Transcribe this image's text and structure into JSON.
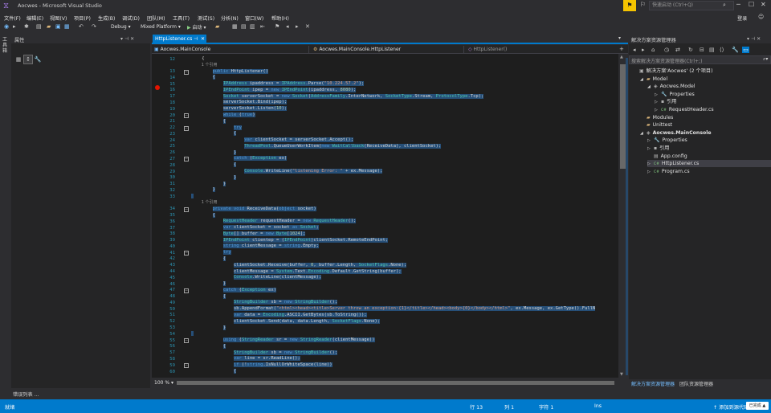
{
  "window": {
    "title": "Aocwes - Microsoft Visual Studio",
    "quick_launch_placeholder": "快速启动 (Ctrl+Q)",
    "login": "登录"
  },
  "menu": [
    "文件(F)",
    "编辑(E)",
    "视图(V)",
    "项目(P)",
    "生成(B)",
    "调试(D)",
    "团队(M)",
    "工具(T)",
    "测试(S)",
    "分析(N)",
    "窗口(W)",
    "帮助(H)"
  ],
  "toolbar": {
    "configuration": "Debug",
    "platform": "Mixed Platform",
    "run_label": "启动"
  },
  "toolstrip": {
    "label": "工具箱"
  },
  "properties": {
    "title": "属性"
  },
  "error_list": {
    "title": "错误列表 ..."
  },
  "editor": {
    "tab_title": "HttpListener.cs",
    "nav_project": "Aocwes.MainConsole",
    "nav_class": "Aocwes.MainConsole.HttpListener",
    "nav_member": "HttpListener()",
    "zoom": "100 %",
    "lines": [
      {
        "n": "12",
        "t": "    {",
        "sel": false
      },
      {
        "n": "",
        "t": "        1 个引用",
        "lens": true
      },
      {
        "n": "13",
        "t": "        public HttpListener()",
        "sel": true
      },
      {
        "n": "14",
        "t": "        {",
        "sel": true
      },
      {
        "n": "15",
        "t": "            IPAddress ipaddress = IPAddress.Parse(\"10.224.57.2\");",
        "sel": true
      },
      {
        "n": "16",
        "t": "            IPEndPoint ipep = new IPEndPoint(ipaddress, 8080);",
        "sel": true
      },
      {
        "n": "17",
        "t": "            Socket serverSocket = new Socket(AddressFamily.InterNetwork, SocketType.Stream, ProtocolType.Tcp);",
        "sel": true
      },
      {
        "n": "18",
        "t": "            serverSocket.Bind(ipep);",
        "sel": true
      },
      {
        "n": "19",
        "t": "            serverSocket.Listen(10);",
        "sel": true
      },
      {
        "n": "20",
        "t": "            while (true)",
        "sel": true
      },
      {
        "n": "21",
        "t": "            {",
        "sel": true
      },
      {
        "n": "22",
        "t": "                try",
        "sel": true
      },
      {
        "n": "23",
        "t": "                {",
        "sel": true
      },
      {
        "n": "24",
        "t": "                    var clientSocket = serverSocket.Accept();",
        "sel": true
      },
      {
        "n": "25",
        "t": "                    ThreadPool.QueueUserWorkItem(new WaitCallback(ReceiveData), clientSocket);",
        "sel": true
      },
      {
        "n": "26",
        "t": "                }",
        "sel": true
      },
      {
        "n": "27",
        "t": "                catch (Exception ex)",
        "sel": true
      },
      {
        "n": "28",
        "t": "                {",
        "sel": true
      },
      {
        "n": "29",
        "t": "                    Console.WriteLine(\"listening Error: \" + ex.Message);",
        "sel": true
      },
      {
        "n": "30",
        "t": "                }",
        "sel": true
      },
      {
        "n": "31",
        "t": "            }",
        "sel": true
      },
      {
        "n": "32",
        "t": "        }",
        "sel": true
      },
      {
        "n": "33",
        "t": "",
        "sel": true
      },
      {
        "n": "",
        "t": "        1 个引用",
        "lens": true
      },
      {
        "n": "34",
        "t": "        private void ReceiveData(object socket)",
        "sel": true
      },
      {
        "n": "35",
        "t": "        {",
        "sel": true
      },
      {
        "n": "36",
        "t": "            RequestHeader requestHeader = new RequestHeader();",
        "sel": true
      },
      {
        "n": "37",
        "t": "            var clientSocket = socket as Socket;",
        "sel": true
      },
      {
        "n": "38",
        "t": "            Byte[] buffer = new Byte[1024];",
        "sel": true
      },
      {
        "n": "39",
        "t": "            IPEndPoint clientep = (IPEndPoint)clientSocket.RemoteEndPoint;",
        "sel": true
      },
      {
        "n": "40",
        "t": "            string clientMessage = string.Empty;",
        "sel": true
      },
      {
        "n": "41",
        "t": "            try",
        "sel": true
      },
      {
        "n": "42",
        "t": "            {",
        "sel": true
      },
      {
        "n": "43",
        "t": "                clientSocket.Receive(buffer, 0, buffer.Length, SocketFlags.None);",
        "sel": true
      },
      {
        "n": "44",
        "t": "                clientMessage = System.Text.Encoding.Default.GetString(buffer);",
        "sel": true
      },
      {
        "n": "45",
        "t": "                Console.WriteLine(clientMessage);",
        "sel": true
      },
      {
        "n": "46",
        "t": "            }",
        "sel": true
      },
      {
        "n": "47",
        "t": "            catch (Exception ex)",
        "sel": true
      },
      {
        "n": "48",
        "t": "            {",
        "sel": true
      },
      {
        "n": "49",
        "t": "                StringBuilder sb = new StringBuilder();",
        "sel": true
      },
      {
        "n": "50",
        "t": "                sb.AppendFormat(\"<html><head><title>Server throw an exception:{1}</title></head><body>{0}</body></html>\", ex.Message, ex.GetType().FullN",
        "sel": true
      },
      {
        "n": "51",
        "t": "                var data = Encoding.ASCII.GetBytes(sb.ToString());",
        "sel": true
      },
      {
        "n": "52",
        "t": "                clientSocket.Send(data, data.Length, SocketFlags.None);",
        "sel": true
      },
      {
        "n": "53",
        "t": "            }",
        "sel": true
      },
      {
        "n": "54",
        "t": "",
        "sel": true
      },
      {
        "n": "55",
        "t": "            using (StringReader sr = new StringReader(clientMessage))",
        "sel": true
      },
      {
        "n": "56",
        "t": "            {",
        "sel": true
      },
      {
        "n": "57",
        "t": "                StringBuilder sb = new StringBuilder();",
        "sel": true
      },
      {
        "n": "58",
        "t": "                var line = sr.ReadLine();",
        "sel": true
      },
      {
        "n": "59",
        "t": "                if (!string.IsNullOrWhiteSpace(line))",
        "sel": true
      },
      {
        "n": "60",
        "t": "                {",
        "sel": true
      }
    ]
  },
  "solution_explorer": {
    "title": "解决方案资源管理器",
    "search_placeholder": "搜索解决方案资源管理器(Ctrl+;)",
    "items": [
      {
        "label": "解决方案'Aocwes' (2 个项目)",
        "depth": 0,
        "icon": "▣",
        "arrow": "",
        "bold": false
      },
      {
        "label": "Model",
        "depth": 1,
        "icon": "▰",
        "arrow": "◢",
        "bold": false
      },
      {
        "label": "Aocwes.Model",
        "depth": 2,
        "icon": "◈",
        "arrow": "◢",
        "bold": false
      },
      {
        "label": "Properties",
        "depth": 3,
        "icon": "🔧",
        "arrow": "▷",
        "bold": false
      },
      {
        "label": "引用",
        "depth": 3,
        "icon": "▪",
        "arrow": "▷",
        "bold": false
      },
      {
        "label": "RequestHeader.cs",
        "depth": 3,
        "icon": "C#",
        "arrow": "▷",
        "bold": false
      },
      {
        "label": "Modules",
        "depth": 1,
        "icon": "▰",
        "arrow": "",
        "bold": false
      },
      {
        "label": "Unittest",
        "depth": 1,
        "icon": "▰",
        "arrow": "",
        "bold": false
      },
      {
        "label": "Aocwes.MainConsole",
        "depth": 1,
        "icon": "◈",
        "arrow": "◢",
        "bold": true
      },
      {
        "label": "Properties",
        "depth": 2,
        "icon": "🔧",
        "arrow": "▷",
        "bold": false
      },
      {
        "label": "引用",
        "depth": 2,
        "icon": "▪",
        "arrow": "▷",
        "bold": false
      },
      {
        "label": "App.config",
        "depth": 2,
        "icon": "▤",
        "arrow": "",
        "bold": false
      },
      {
        "label": "HttpListener.cs",
        "depth": 2,
        "icon": "C#",
        "arrow": "▷",
        "bold": false
      },
      {
        "label": "Program.cs",
        "depth": 2,
        "icon": "C#",
        "arrow": "▷",
        "bold": false
      }
    ],
    "bottom_tabs": [
      "解决方案资源管理器",
      "团队资源管理器"
    ]
  },
  "status": {
    "ready": "就绪",
    "line": "行 13",
    "col": "列 1",
    "char": "字符 1",
    "ins": "Ins",
    "source_control": "添加到源代码",
    "badge": "已完成 ▲"
  }
}
